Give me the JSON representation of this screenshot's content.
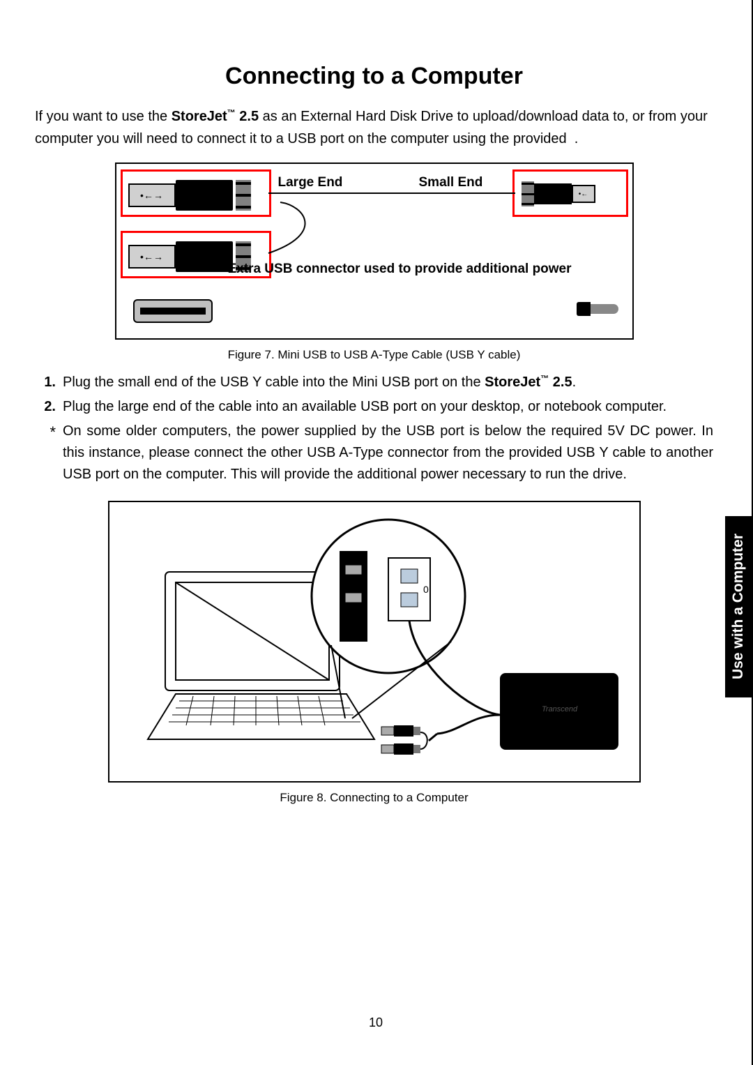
{
  "title": "Connecting to a Computer",
  "intro_pre": "If you want to use the ",
  "product_bold": "StoreJet",
  "product_tm": "™",
  "product_suffix": " 2.5",
  "intro_post": " as an External Hard Disk Drive to upload/download data to, or from your computer you will need to connect it to a USB port on the computer using the provided  .",
  "fig7": {
    "large_end": "Large End",
    "small_end": "Small End",
    "extra_note": "Extra USB connector used to provide additional power",
    "caption": "Figure 7. Mini USB to USB A-Type Cable (USB Y cable)"
  },
  "steps": {
    "s1_marker": "1.",
    "s1_pre": "Plug the small end of the USB Y cable into the Mini USB port on the ",
    "s1_bold": "StoreJet",
    "s1_tm": "™",
    "s1_suffix": " 2.5",
    "s1_post": ".",
    "s2_marker": "2.",
    "s2_text": "Plug the large end of the cable into an available USB port on your desktop, or notebook computer.",
    "note_marker": "*",
    "note_text": "On some older computers, the power supplied by the USB port is below the required 5V DC power. In this instance, please connect the other USB A-Type connector from the provided USB Y cable to another USB port on the computer. This will provide the additional power necessary to run the drive."
  },
  "fig8_caption": "Figure 8. Connecting to a Computer",
  "sidebar": "Use with a Computer",
  "page_number": "10"
}
